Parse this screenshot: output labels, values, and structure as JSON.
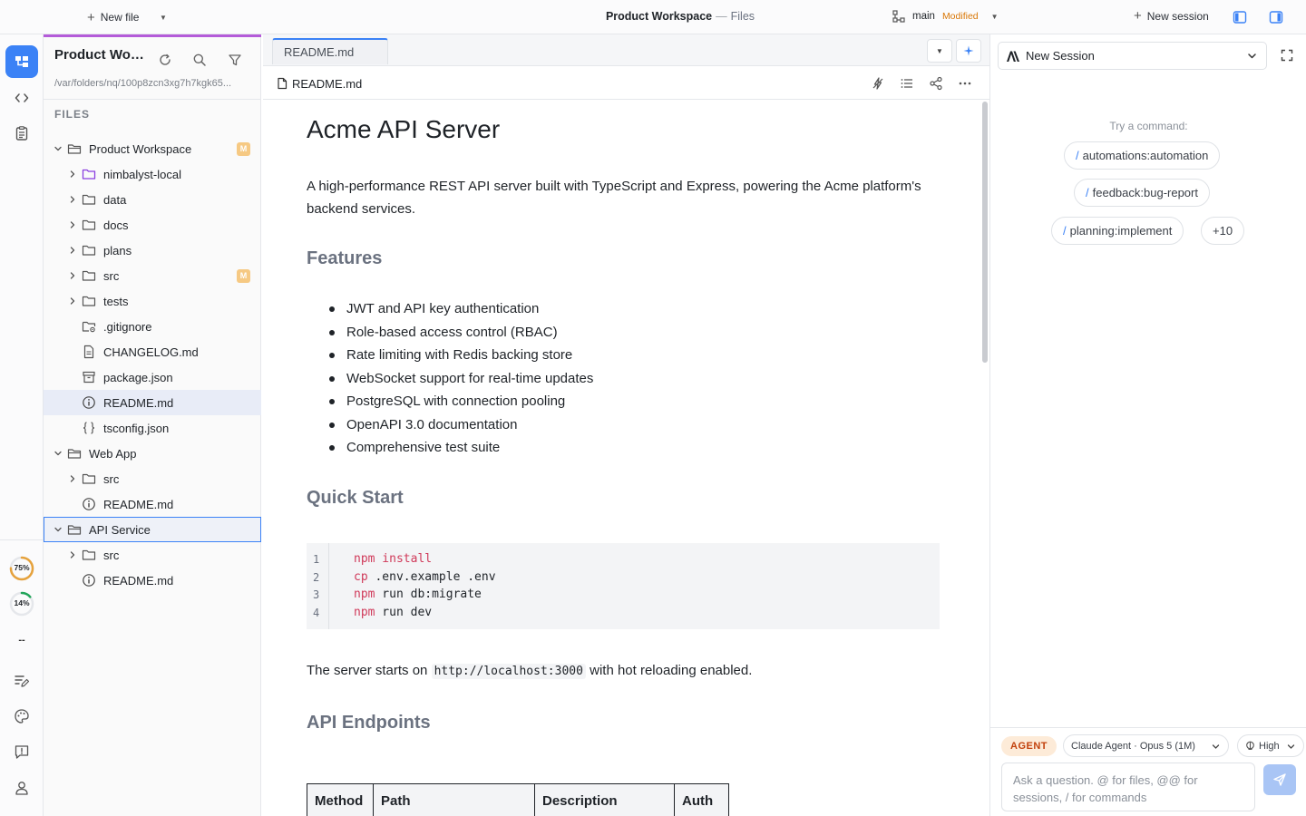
{
  "topbar": {
    "new_file_label": "New file",
    "title": "Product Workspace",
    "title_separator": "—",
    "subtitle": "Files",
    "branch": "main",
    "branch_status": "Modified",
    "new_session_label": "New session"
  },
  "activity": {
    "usage_rings": [
      {
        "label": "75%",
        "value": 0.75,
        "color": "#e6a23c"
      },
      {
        "label": "14%",
        "value": 0.14,
        "color": "#22a55a"
      }
    ],
    "placeholder_label": "--",
    "active_color": "#3b82f6"
  },
  "explorer": {
    "title": "Product Workspace",
    "path": "/var/folders/nq/100p8zcn3xg7h7kgk65...",
    "section_label": "FILES",
    "modified_badge": "M",
    "tree": [
      {
        "label": "Product Workspace",
        "kind": "workspace",
        "expanded": true,
        "badge": true
      },
      {
        "label": "nimbalyst-local",
        "kind": "folder-purple"
      },
      {
        "label": "data",
        "kind": "folder"
      },
      {
        "label": "docs",
        "kind": "folder"
      },
      {
        "label": "plans",
        "kind": "folder"
      },
      {
        "label": "src",
        "kind": "folder",
        "badge": true
      },
      {
        "label": "tests",
        "kind": "folder"
      },
      {
        "label": ".gitignore",
        "kind": "gear-folder"
      },
      {
        "label": "CHANGELOG.md",
        "kind": "doc"
      },
      {
        "label": "package.json",
        "kind": "archive"
      },
      {
        "label": "README.md",
        "kind": "info",
        "selected": true
      },
      {
        "label": "tsconfig.json",
        "kind": "braces"
      },
      {
        "label": "Web App",
        "kind": "workspace",
        "expanded": true
      },
      {
        "label": "src",
        "kind": "folder"
      },
      {
        "label": "README.md",
        "kind": "info"
      },
      {
        "label": "API Service",
        "kind": "workspace",
        "expanded": true,
        "focused": true
      },
      {
        "label": "src",
        "kind": "folder"
      },
      {
        "label": "README.md",
        "kind": "info"
      }
    ]
  },
  "editor": {
    "tab_label": "README.md",
    "file_name": "README.md",
    "doc": {
      "h1": "Acme API Server",
      "intro": "A high-performance REST API server built with TypeScript and Express, powering the Acme platform's backend services.",
      "features_heading": "Features",
      "features": [
        "JWT and API key authentication",
        "Role-based access control (RBAC)",
        "Rate limiting with Redis backing store",
        "WebSocket support for real-time updates",
        "PostgreSQL with connection pooling",
        "OpenAPI 3.0 documentation",
        "Comprehensive test suite"
      ],
      "quickstart_heading": "Quick Start",
      "code_lines": [
        {
          "num": "1",
          "cmd": "npm",
          "rest": " install",
          "rest_is_keyword": true
        },
        {
          "num": "2",
          "cmd": "cp",
          "rest": " .env.example .env",
          "rest_is_keyword": false
        },
        {
          "num": "3",
          "cmd": "npm",
          "rest": " run db:migrate",
          "rest_is_keyword": false
        },
        {
          "num": "4",
          "cmd": "npm",
          "rest": " run dev",
          "rest_is_keyword": false
        }
      ],
      "server_text_before": "The server starts on ",
      "server_url": "http://localhost:3000",
      "server_text_after": " with hot reloading enabled.",
      "endpoints_heading": "API Endpoints",
      "table_headers": [
        "Method",
        "Path",
        "Description",
        "Auth"
      ]
    }
  },
  "rpanel": {
    "session_select": "New Session",
    "hint": "Try a command:",
    "commands": [
      "automations:automation",
      "feedback:bug-report",
      "planning:implement"
    ],
    "more_commands": "+10",
    "agent_badge": "AGENT",
    "model_label": "Claude Agent · Opus 5 (1M)",
    "effort_label": "High",
    "input_placeholder": "Ask a question. @ for files, @@ for sessions, / for commands"
  }
}
